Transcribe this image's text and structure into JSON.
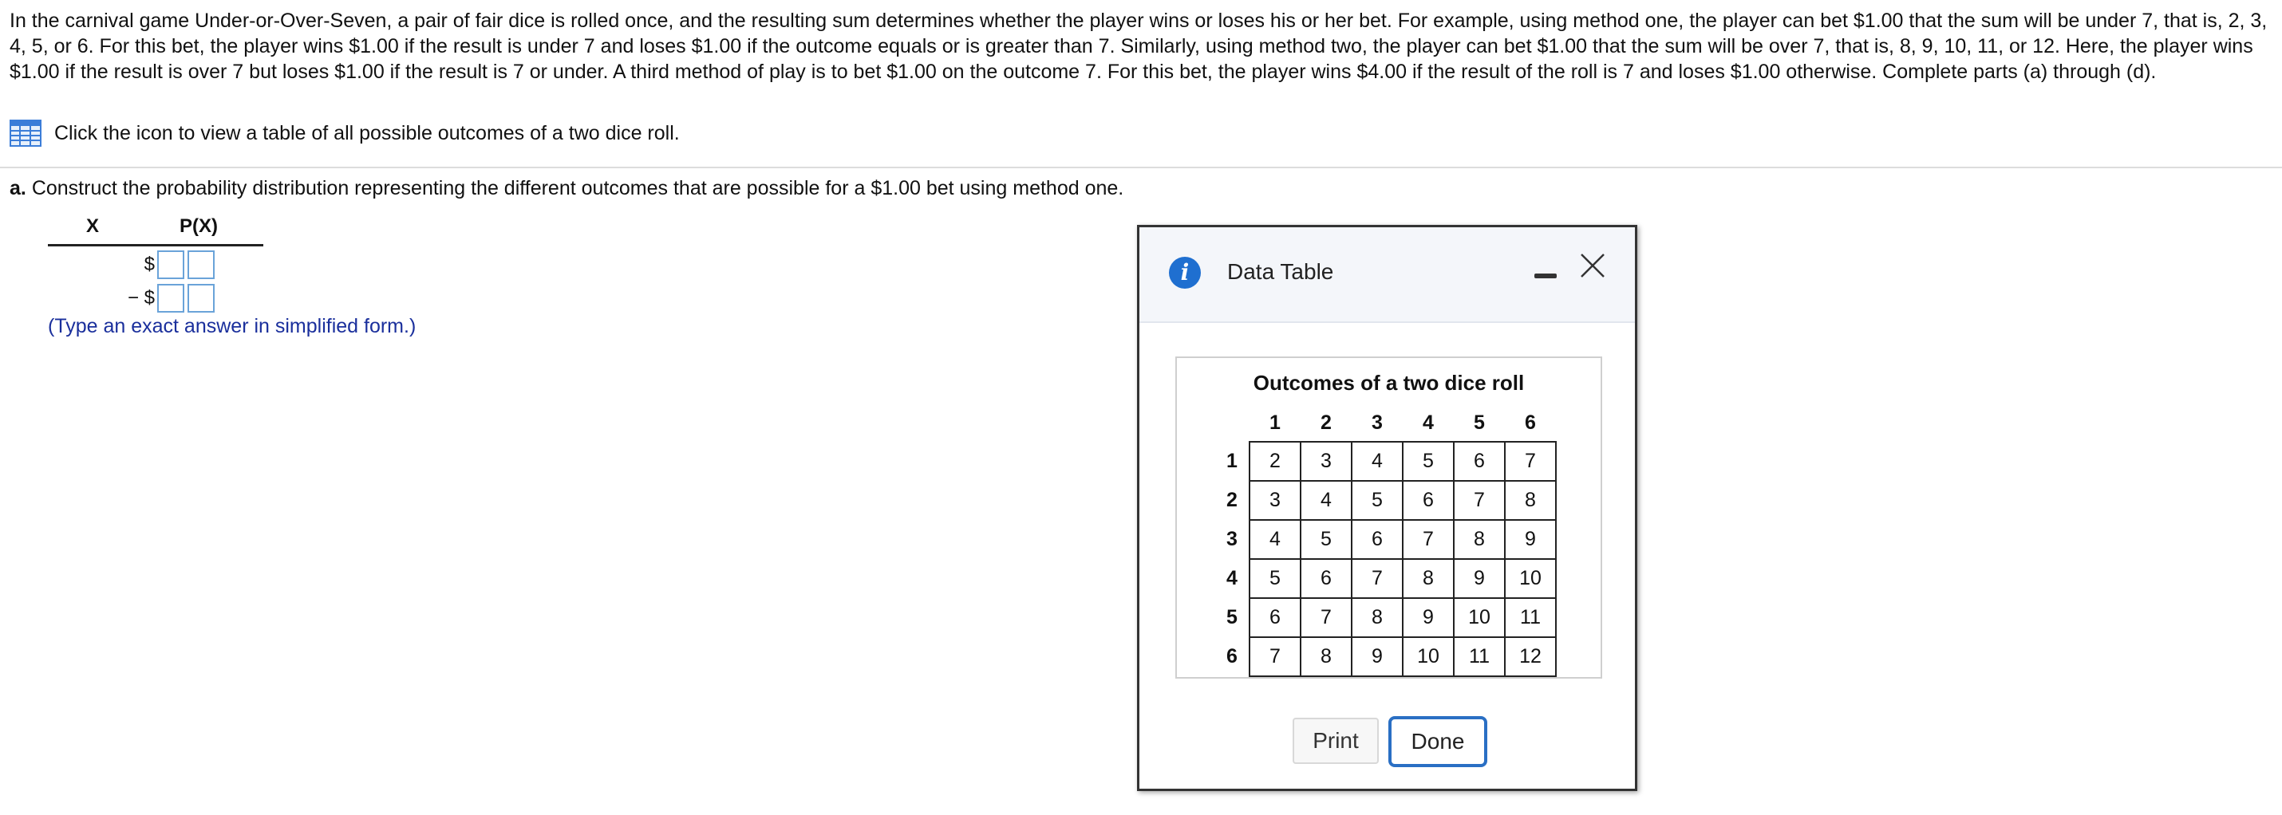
{
  "problem": {
    "text": "In the carnival game Under-or-Over-Seven, a pair of fair dice is rolled once, and the resulting sum determines whether the player wins or loses his or her bet. For example, using method one, the player can bet $1.00 that the sum will be under 7, that is, 2, 3, 4, 5, or 6. For this bet, the player wins $1.00 if the result is under 7 and loses $1.00 if the outcome equals or is greater than 7. Similarly, using method two, the player can bet $1.00 that the sum will be over 7, that is, 8, 9, 10, 11, or 12. Here, the player wins $1.00 if the result is over 7 but loses $1.00 if the result is 7 or under. A third method of play is to bet $1.00 on the outcome 7. For this bet, the player wins $4.00 if the result of the roll is 7 and loses $1.00 otherwise. Complete parts (a) through (d)."
  },
  "table_link": {
    "text": "Click the icon to view a table of all possible outcomes of a two dice roll.",
    "icon": "table-icon"
  },
  "part_a": {
    "label": "a.",
    "text": "Construct the probability distribution representing the different outcomes that are possible for a $1.00 bet using method one."
  },
  "prob_table": {
    "headers": [
      "X",
      "P(X)"
    ],
    "rows": [
      {
        "sign": "$"
      },
      {
        "sign": "− $"
      }
    ],
    "hint": "(Type an exact answer in simplified form.)"
  },
  "dialog": {
    "title": "Data Table",
    "table_title": "Outcomes of a two dice roll",
    "columns": [
      "1",
      "2",
      "3",
      "4",
      "5",
      "6"
    ],
    "rows": [
      {
        "label": "1",
        "cells": [
          "2",
          "3",
          "4",
          "5",
          "6",
          "7"
        ]
      },
      {
        "label": "2",
        "cells": [
          "3",
          "4",
          "5",
          "6",
          "7",
          "8"
        ]
      },
      {
        "label": "3",
        "cells": [
          "4",
          "5",
          "6",
          "7",
          "8",
          "9"
        ]
      },
      {
        "label": "4",
        "cells": [
          "5",
          "6",
          "7",
          "8",
          "9",
          "10"
        ]
      },
      {
        "label": "5",
        "cells": [
          "6",
          "7",
          "8",
          "9",
          "10",
          "11"
        ]
      },
      {
        "label": "6",
        "cells": [
          "7",
          "8",
          "9",
          "10",
          "11",
          "12"
        ]
      }
    ],
    "print_label": "Print",
    "done_label": "Done"
  },
  "colors": {
    "accent": "#2a6fc4",
    "hint_text": "#1a2f9c",
    "input_border": "#6aa3d9",
    "info_icon": "#1f6fd0"
  }
}
